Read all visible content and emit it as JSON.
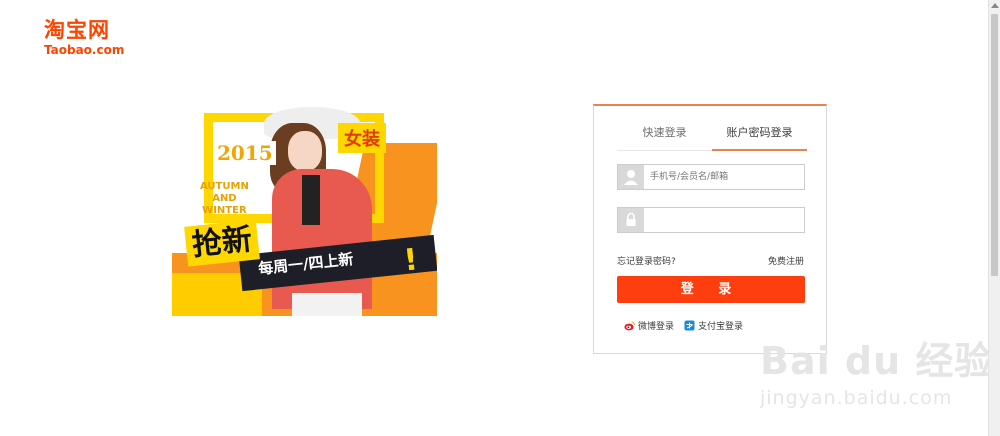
{
  "logo": {
    "cn": "淘宝网",
    "en": "Taobao.com"
  },
  "banner": {
    "year": "2015",
    "category": "女装",
    "season": [
      "AUTUMN",
      "AND",
      "WINTER"
    ],
    "headline": "抢新",
    "slogan": "每周一/四上新",
    "exclaim": "!"
  },
  "login": {
    "tabs": [
      {
        "label": "快速登录"
      },
      {
        "label": "账户密码登录"
      }
    ],
    "username": {
      "placeholder": "手机号/会员名/邮箱",
      "value": ""
    },
    "password": {
      "placeholder": "",
      "value": ""
    },
    "forgot": "忘记登录密码?",
    "register": "免费注册",
    "submit": "登 录",
    "social": {
      "weibo": "微博登录",
      "alipay": "支付宝登录"
    }
  },
  "watermark": {
    "main": "Bai du 经验",
    "sub": "jingyan.baidu.com"
  },
  "colors": {
    "brand": "#ff4400",
    "button": "#ff3e0f",
    "tab_accent": "#e8844a"
  },
  "icons": [
    "user-icon",
    "lock-icon",
    "weibo-icon",
    "alipay-icon"
  ]
}
